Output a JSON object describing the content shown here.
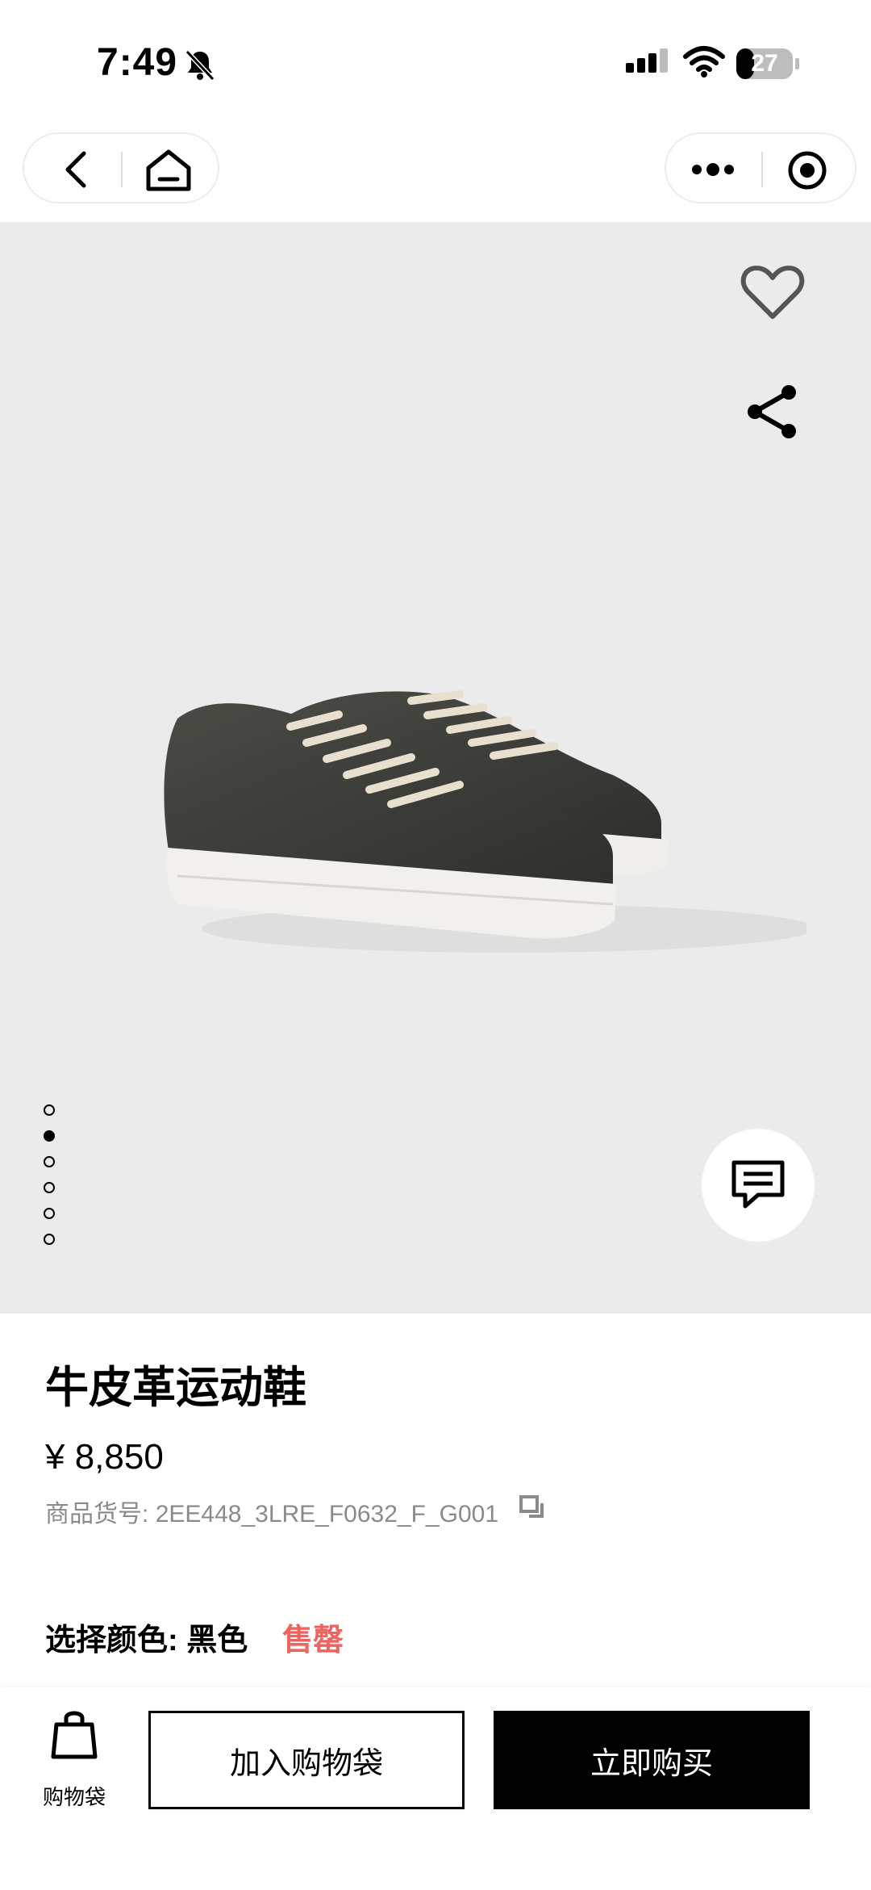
{
  "status_bar": {
    "time": "7:49",
    "battery_level": "27"
  },
  "product": {
    "title": "牛皮革运动鞋",
    "price": "¥ 8,850",
    "sku_label": "商品货号:",
    "sku_value": "2EE448_3LRE_F0632_F_G001",
    "color_label": "选择颜色:",
    "color_value": "黑色",
    "availability": "售罄",
    "image_count": 6,
    "active_image_index": 1
  },
  "bottom_bar": {
    "bag_label": "购物袋",
    "add_to_bag_label": "加入购物袋",
    "buy_now_label": "立即购买"
  },
  "colors": {
    "hero_background": "#ebebeb",
    "sold_out": "#f0625f",
    "sku_text": "#8a8a8a",
    "primary_button": "#000000"
  },
  "icons": [
    "silent-bell-icon",
    "signal-icon",
    "wifi-icon",
    "battery-icon",
    "back-icon",
    "home-icon",
    "more-icon",
    "target-icon",
    "heart-icon",
    "share-icon",
    "chat-icon",
    "copy-icon",
    "bag-icon"
  ]
}
